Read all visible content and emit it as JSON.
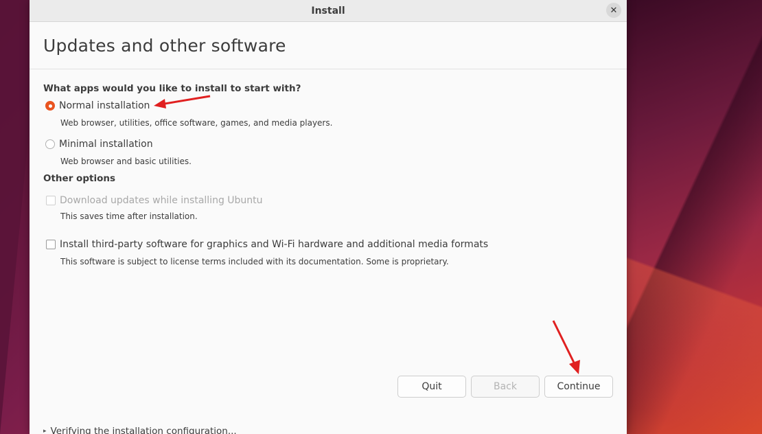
{
  "window": {
    "title": "Install",
    "close_icon": "✕"
  },
  "page": {
    "title": "Updates and other software"
  },
  "apps": {
    "question": "What apps would you like to install to start with?",
    "options": [
      {
        "label": "Normal installation",
        "description": "Web browser, utilities, office software, games, and media players.",
        "selected": true
      },
      {
        "label": "Minimal installation",
        "description": "Web browser and basic utilities.",
        "selected": false
      }
    ]
  },
  "other_options": {
    "title": "Other options",
    "items": [
      {
        "label": "Download updates while installing Ubuntu",
        "description": "This saves time after installation.",
        "checked": false,
        "enabled": false
      },
      {
        "label": "Install third-party software for graphics and Wi-Fi hardware and additional media formats",
        "description": "This software is subject to license terms included with its documentation. Some is proprietary.",
        "checked": false,
        "enabled": true
      }
    ]
  },
  "buttons": {
    "quit": "Quit",
    "back": "Back",
    "continue": "Continue"
  },
  "footer": {
    "caret": "▸",
    "text": "Verifying the installation configuration..."
  },
  "colors": {
    "accent": "#e95420",
    "annotation_arrow": "#e02020"
  }
}
